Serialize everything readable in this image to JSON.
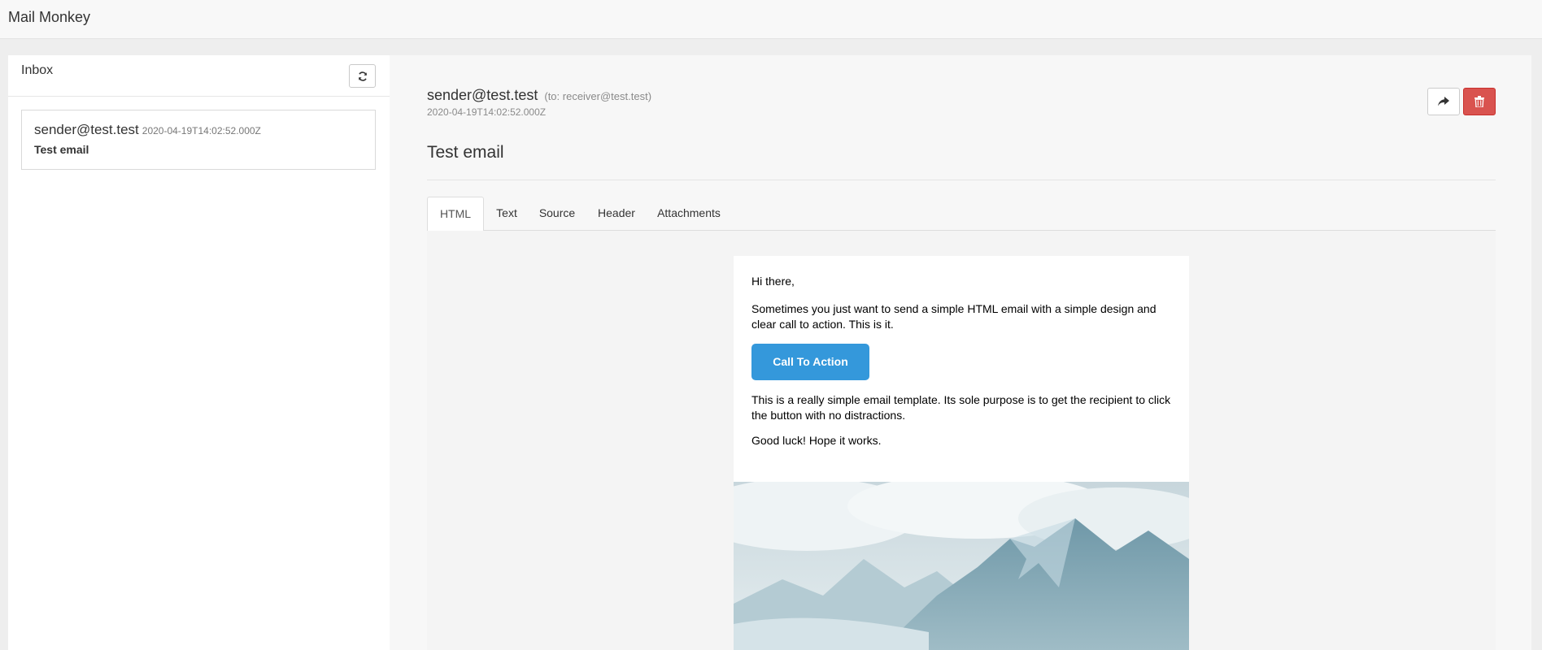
{
  "app": {
    "title": "Mail Monkey"
  },
  "inbox": {
    "title": "Inbox",
    "refresh_icon": "refresh-icon",
    "messages": [
      {
        "from": "sender@test.test",
        "date": "2020-04-19T14:02:52.000Z",
        "subject": "Test email"
      }
    ]
  },
  "detail": {
    "from": "sender@test.test",
    "to": "(to: receiver@test.test)",
    "date": "2020-04-19T14:02:52.000Z",
    "subject": "Test email",
    "forward_icon": "share-arrow-icon",
    "delete_icon": "trash-icon",
    "tabs": [
      {
        "label": "HTML",
        "active": true
      },
      {
        "label": "Text",
        "active": false
      },
      {
        "label": "Source",
        "active": false
      },
      {
        "label": "Header",
        "active": false
      },
      {
        "label": "Attachments",
        "active": false
      }
    ]
  },
  "email_html": {
    "greeting": "Hi there,",
    "intro": "Sometimes you just want to send a simple HTML email with a simple design and clear call to action. This is it.",
    "cta_label": "Call To Action",
    "body": "This is a really simple email template. Its sole purpose is to get the recipient to click the button with no distractions.",
    "closing": "Good luck! Hope it works.",
    "image": "mountain-landscape-image"
  },
  "colors": {
    "cta": "#3498db",
    "delete": "#d9534f",
    "navbar": "#f8f8f8",
    "page_bg": "#eeeeee"
  }
}
